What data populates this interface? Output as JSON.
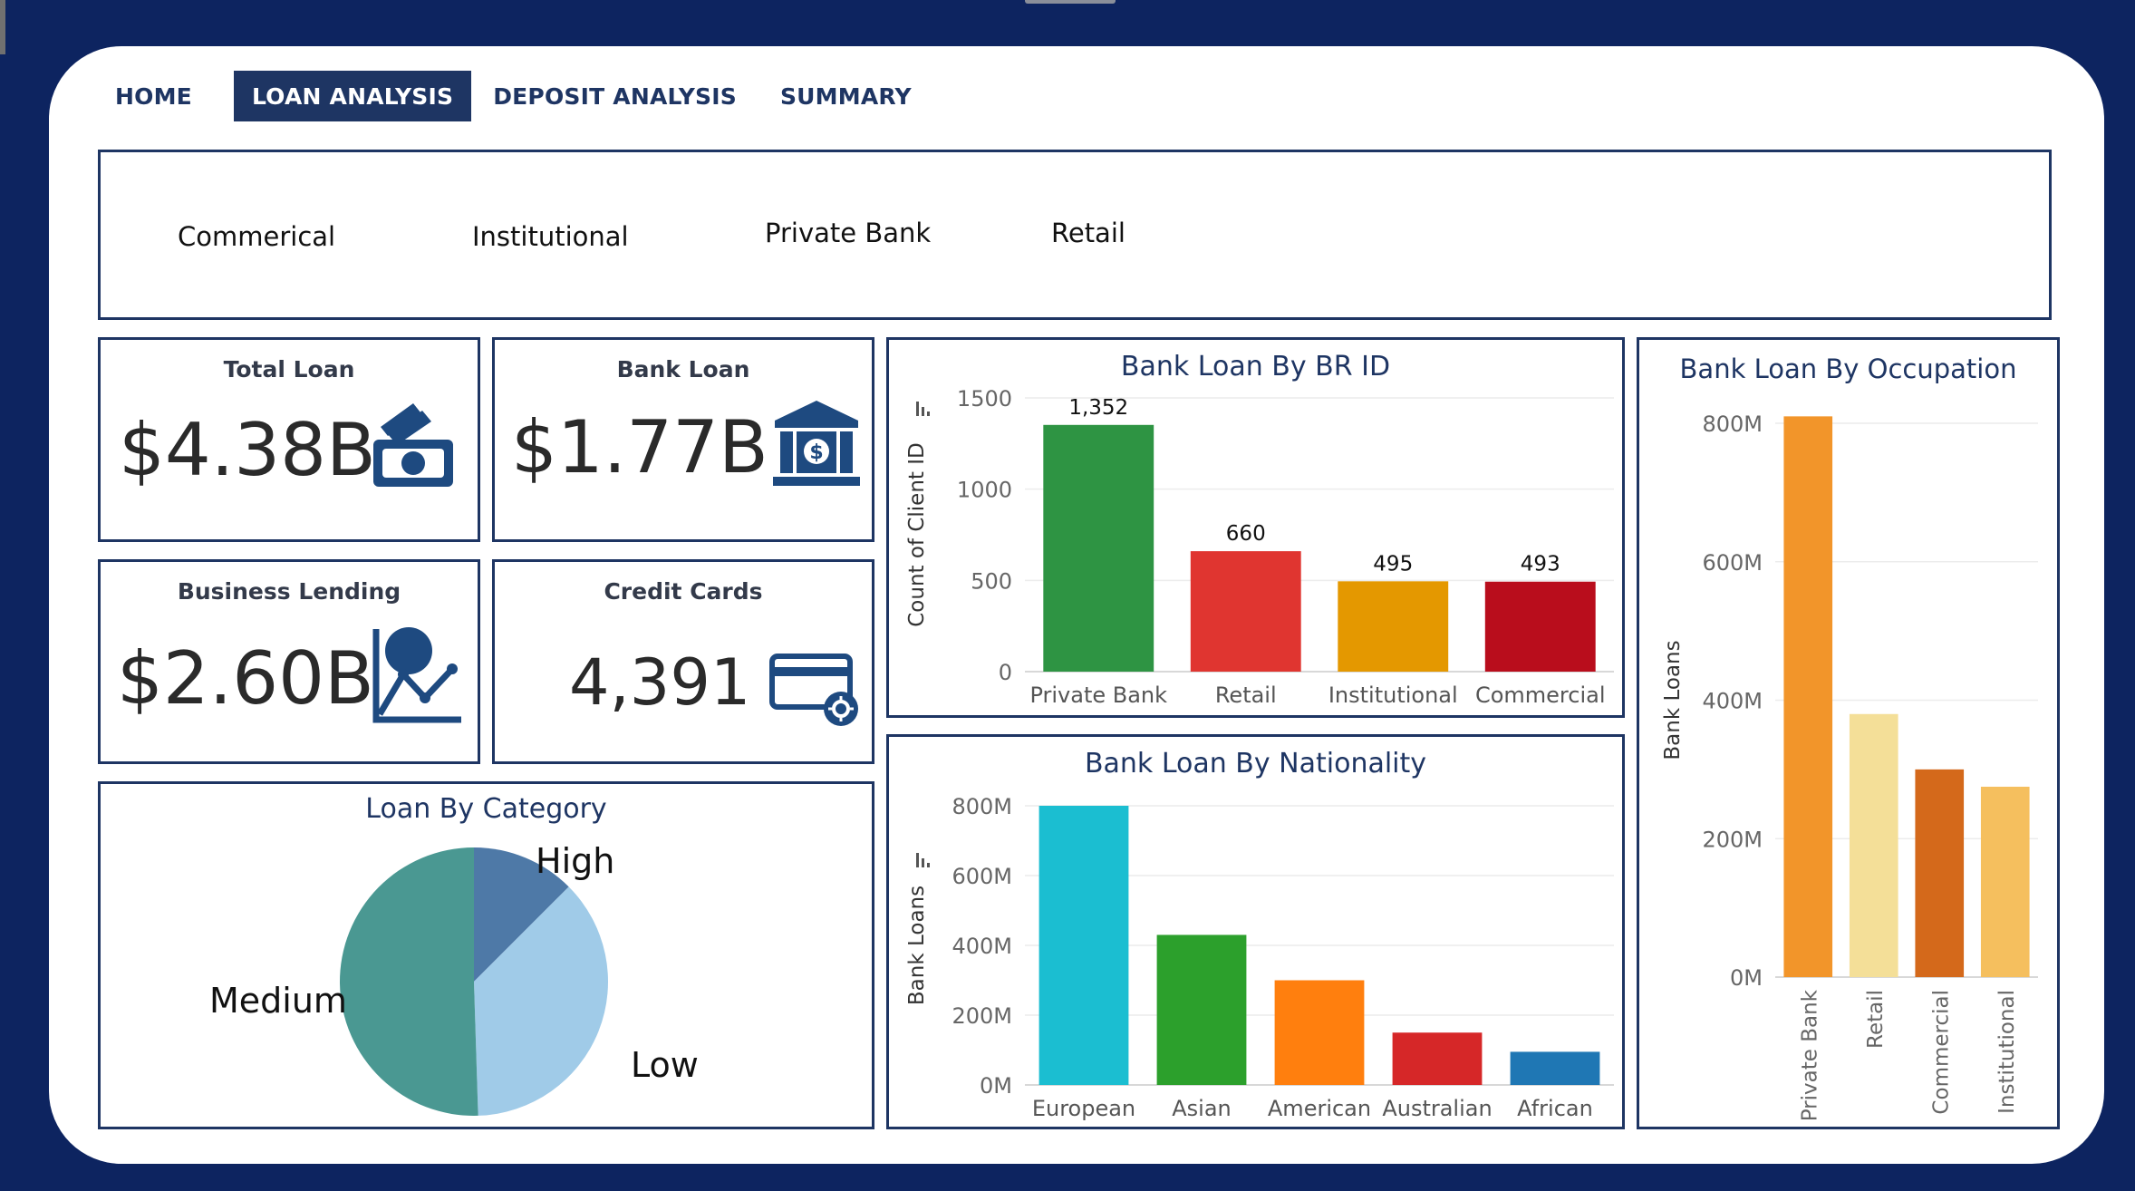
{
  "nav": {
    "tabs": [
      {
        "label": "HOME"
      },
      {
        "label": "LOAN ANALYSIS",
        "active": true
      },
      {
        "label": "DEPOSIT ANALYSIS"
      },
      {
        "label": "SUMMARY"
      }
    ]
  },
  "filters": [
    "Commerical",
    "Institutional",
    "Private Bank",
    "Retail"
  ],
  "kpis": {
    "total_loan": {
      "title": "Total Loan",
      "value": "$4.38B",
      "icon": "cash-icon"
    },
    "bank_loan": {
      "title": "Bank Loan",
      "value": "$1.77B",
      "icon": "bank-icon"
    },
    "business_lending": {
      "title": "Business Lending",
      "value": "$2.60B",
      "icon": "growth-chart-icon"
    },
    "credit_cards": {
      "title": "Credit Cards",
      "value": "4,391",
      "icon": "credit-card-icon"
    }
  },
  "colors": {
    "page_bg": "#0d2460",
    "panel_border": "#1e3563",
    "active_tab": "#1e3563"
  },
  "chart_data": [
    {
      "id": "br_id",
      "type": "bar",
      "title": "Bank Loan By BR ID",
      "ylabel": "Count of Client ID",
      "categories": [
        "Private Bank",
        "Retail",
        "Institutional",
        "Commercial"
      ],
      "values": [
        1352,
        660,
        495,
        493
      ],
      "value_labels": [
        "1,352",
        "660",
        "495",
        "493"
      ],
      "colors": [
        "#2e9443",
        "#e03530",
        "#e49800",
        "#b90d1c"
      ],
      "yticks": [
        0,
        500,
        1000,
        1500
      ],
      "ytick_labels": [
        "0",
        "500",
        "1000",
        "1500"
      ],
      "ylim": [
        0,
        1500
      ]
    },
    {
      "id": "nationality",
      "type": "bar",
      "title": "Bank Loan By Nationality",
      "ylabel": "Bank Loans",
      "categories": [
        "European",
        "Asian",
        "American",
        "Australian",
        "African"
      ],
      "values": [
        800,
        430,
        300,
        150,
        95
      ],
      "colors": [
        "#1bbed1",
        "#2ca02c",
        "#ff7f0e",
        "#d62728",
        "#1f77b4"
      ],
      "yticks": [
        0,
        200,
        400,
        600,
        800
      ],
      "ytick_labels": [
        "0M",
        "200M",
        "400M",
        "600M",
        "800M"
      ],
      "ylim": [
        0,
        800
      ]
    },
    {
      "id": "occupation",
      "type": "bar",
      "title": "Bank Loan By Occupation",
      "ylabel": "Bank Loans",
      "categories": [
        "Private Bank",
        "Retail",
        "Commercial",
        "Institutional"
      ],
      "values": [
        810,
        380,
        300,
        275
      ],
      "colors": [
        "#f2952a",
        "#f4df98",
        "#d4691b",
        "#f5bf5e"
      ],
      "yticks": [
        0,
        200,
        400,
        600,
        800
      ],
      "ytick_labels": [
        "0M",
        "200M",
        "400M",
        "600M",
        "800M"
      ],
      "ylim": [
        0,
        800
      ]
    },
    {
      "id": "category",
      "type": "pie",
      "title": "Loan By Category",
      "slices": [
        {
          "label": "High",
          "value": 0.125,
          "color": "#4e79a7"
        },
        {
          "label": "Low",
          "value": 0.37,
          "color": "#a0cbe8"
        },
        {
          "label": "Medium",
          "value": 0.505,
          "color": "#4a9892"
        }
      ]
    }
  ]
}
